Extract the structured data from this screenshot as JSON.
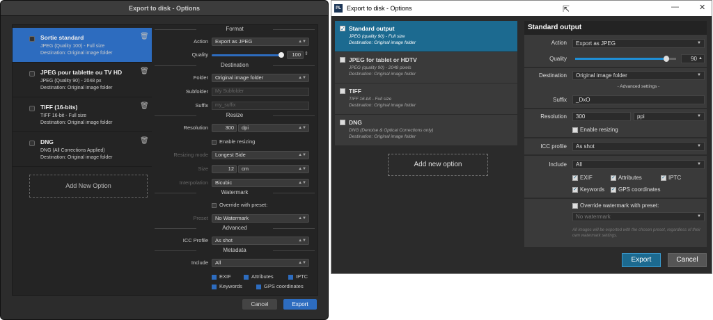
{
  "mac": {
    "title": "Export to disk - Options",
    "options": [
      {
        "name": "Sortie standard",
        "line1": "JPEG (Quality 100) - Full size",
        "line2": "Destination: Original image folder"
      },
      {
        "name": "JPEG pour tablette ou TV HD",
        "line1": "JPEG (Quality 90) - 2048 px",
        "line2": "Destination: Original image folder"
      },
      {
        "name": "TIFF (16-bits)",
        "line1": "TIFF 16-bit - Full size",
        "line2": "Destination: Original image folder"
      },
      {
        "name": "DNG",
        "line1": "DNG (All Corrections Applied)",
        "line2": "Destination: Original image folder"
      }
    ],
    "add_option": "Add New Option",
    "sections": {
      "format": "Format",
      "destination": "Destination",
      "resize": "Resize",
      "watermark": "Watermark",
      "advanced": "Advanced",
      "metadata": "Metadata"
    },
    "labels": {
      "action": "Action",
      "quality": "Quality",
      "folder": "Folder",
      "subfolder": "Subfolder",
      "suffix": "Suffix",
      "resolution": "Resolution",
      "resizing_mode": "Resizing mode",
      "size": "Size",
      "interpolation": "Interpolation",
      "preset": "Preset",
      "icc_profile": "ICC Profile",
      "include": "Include"
    },
    "values": {
      "action": "Export as JPEG",
      "quality": "100",
      "quality_fraction": 1.0,
      "folder": "Original image folder",
      "subfolder_ph": "My Subfolder",
      "suffix_ph": "my_suffix",
      "resolution": "300",
      "resolution_unit": "dpi",
      "enable_resizing": "Enable resizing",
      "resizing_mode": "Longest Side",
      "size": "12",
      "size_unit": "cm",
      "interpolation": "Bicubic",
      "override": "Override with preset:",
      "preset": "No Watermark",
      "icc": "As shot",
      "include": "All"
    },
    "meta": {
      "exif": "EXIF",
      "attributes": "Attributes",
      "iptc": "IPTC",
      "keywords": "Keywords",
      "gps": "GPS coordinates"
    },
    "cancel": "Cancel",
    "export": "Export"
  },
  "win": {
    "title": "Export to disk - Options",
    "logo": "PL",
    "options": [
      {
        "name": "Standard output",
        "line1": "JPEG (quality 90) - Full size",
        "line2": "Destination: Original image folder"
      },
      {
        "name": "JPEG for tablet or HDTV",
        "line1": "JPEG (quality 90) - 2048 pixels",
        "line2": "Destination: Original image folder"
      },
      {
        "name": "TIFF",
        "line1": "TIFF 16-bit - Full size",
        "line2": "Destination: Original image folder"
      },
      {
        "name": "DNG",
        "line1": "DNG (Denoise & Optical Corrections only)",
        "line2": "Destination: Original image folder"
      }
    ],
    "add_option": "Add new option",
    "panel_title": "Standard output",
    "labels": {
      "action": "Action",
      "quality": "Quality",
      "destination": "Destination",
      "advanced": "- Advanced settings -",
      "suffix": "Suffix",
      "resolution": "Resolution",
      "icc_profile": "ICC profile",
      "include": "Include"
    },
    "values": {
      "action": "Export as JPEG",
      "quality": "90",
      "quality_fraction": 0.9,
      "destination": "Original image folder",
      "suffix": "_DxO",
      "resolution": "300",
      "resolution_unit": "ppi",
      "enable_resizing": "Enable resizing",
      "icc": "As shot",
      "include": "All",
      "override": "Override watermark with preset:",
      "watermark": "No watermark",
      "note": "All images will be exported with the chosen preset, regardless of their own watermark settings."
    },
    "meta": {
      "exif": "EXIF",
      "attributes": "Attributes",
      "iptc": "IPTC",
      "keywords": "Keywords",
      "gps": "GPS coordinates"
    },
    "export": "Export",
    "cancel": "Cancel"
  }
}
